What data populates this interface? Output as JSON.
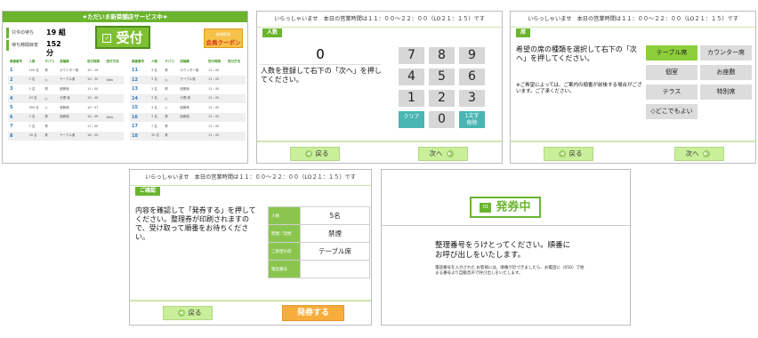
{
  "panel1": {
    "banner": "★ただいま新菜舗店サービス中★",
    "wait_groups_label": "只今の待ち",
    "wait_groups_value": "19 組",
    "wait_time_label": "待ち時間目安",
    "wait_time_value": "152 分",
    "reception_button": "受付",
    "coupon_top": "新規登録",
    "coupon_label": "会員クーポン",
    "columns": [
      "順番番号",
      "人数",
      "タバコ",
      "席種類",
      "受付時間",
      "受付方法"
    ],
    "left_rows": [
      [
        "1",
        "100 名",
        "禁",
        "カウンター席",
        "10：19",
        ""
      ],
      [
        "2",
        "3 名",
        "◎",
        "テーブル席",
        "10：20",
        "Web"
      ],
      [
        "3",
        "3 名",
        "禁",
        "座敷席",
        "11：00",
        ""
      ],
      [
        "4",
        "93 名",
        "◎",
        "分煙 席",
        "10：40",
        ""
      ],
      [
        "5",
        "999 名",
        "◎",
        "座敷席",
        "10：57",
        ""
      ],
      [
        "6",
        "3 名",
        "禁",
        "座敷席",
        "10：59",
        "Web"
      ],
      [
        "7",
        "7 名",
        "禁",
        "",
        "17：00",
        ""
      ],
      [
        "8",
        "30 名",
        "禁",
        "テーブル席",
        "18：59",
        ""
      ]
    ],
    "right_rows": [
      [
        "11",
        "3 名",
        "禁",
        "カウンター席",
        "11：00",
        ""
      ],
      [
        "12",
        "3 名",
        "◎",
        "テーブル席",
        "11：00",
        ""
      ],
      [
        "13",
        "3 名",
        "禁",
        "座敷席",
        "11：00",
        ""
      ],
      [
        "14",
        "3 名",
        "◎",
        "分煙 席",
        "11：00",
        ""
      ],
      [
        "15",
        "3 名",
        "◎",
        "座敷席",
        "11：00",
        ""
      ],
      [
        "16",
        "3 名",
        "禁",
        "座敷席",
        "11：00",
        ""
      ],
      [
        "17",
        "7 名",
        "禁",
        "",
        "11：00",
        ""
      ],
      [
        "18",
        "30 名",
        "禁",
        "",
        "11：00",
        ""
      ]
    ]
  },
  "header_text": "いらっしゃいませ　本日の営業時間は１１：００～２２：００（LO２１：１５）です",
  "back_label": "戻る",
  "next_label": "次へ",
  "panel2": {
    "section": "人数",
    "count": "0",
    "instruction": "人数を登録して右下の「次へ」を押してください。",
    "keys": [
      "7",
      "8",
      "9",
      "4",
      "5",
      "6",
      "1",
      "2",
      "3"
    ],
    "clear": "クリア",
    "zero": "0",
    "delete": "1文字削除"
  },
  "panel3": {
    "section": "席",
    "instruction": "希望の席の種類を選択して右下の「次へ」を押してください。",
    "note": "※ご希望によっては、ご案内の順番が前後する場合がございます。ご了承ください。",
    "seats": [
      "テーブル席",
      "カウンター席",
      "個室",
      "お座敷",
      "テラス",
      "特別席",
      "◇どこでもよい"
    ]
  },
  "panel4": {
    "section": "ご確認",
    "instruction": "内容を確認して「発券する」を押してください。整理券が印刷されますので、受け取って順番をお待ちください。",
    "rows": [
      [
        "人数",
        "5名"
      ],
      [
        "喫煙／禁煙",
        "禁煙"
      ],
      [
        "ご希望の席",
        "テーブル席"
      ],
      [
        "電話番号",
        ""
      ]
    ],
    "issue_button": "発券する"
  },
  "panel5": {
    "status": "発券中",
    "message": "整理番号をうけとってください。順番にお呼び出しをいたします。",
    "note": "電話番号を入力された お客様には、順番が近づきましたら、お電話に（050）で始まる番号より自動音声で呼び出しをいたします。"
  }
}
